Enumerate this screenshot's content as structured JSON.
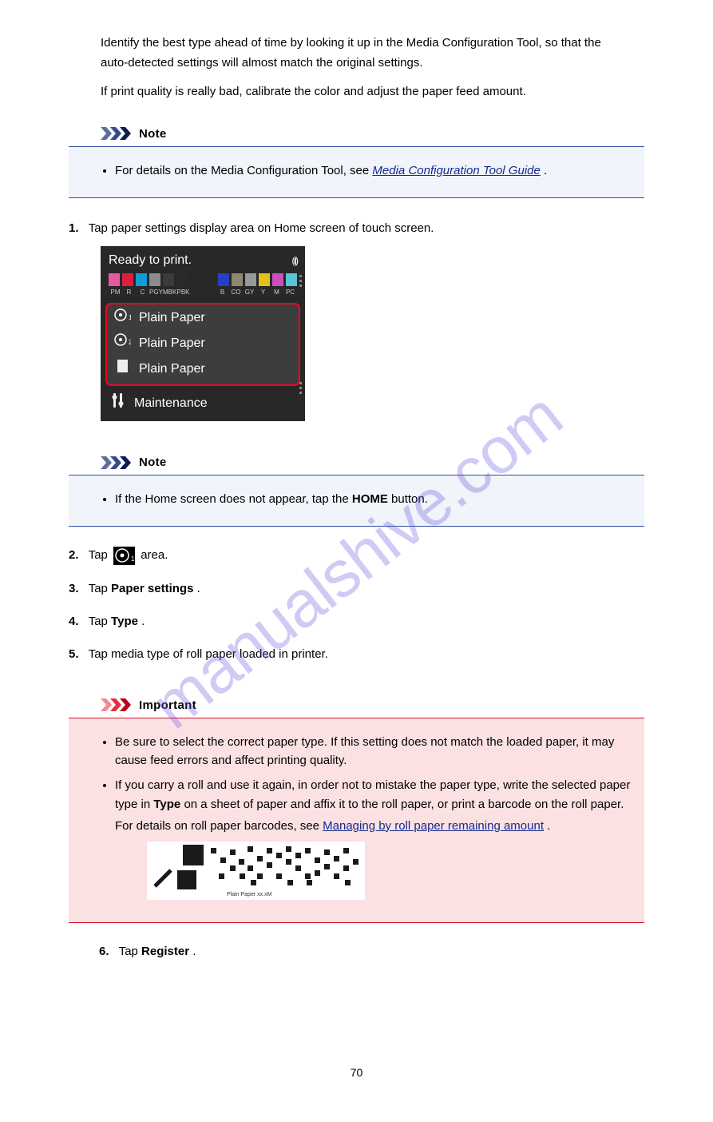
{
  "instructions": {
    "stepA_line1": "Identify the best type ahead of time by looking it up in the Media Configuration Tool, so that the",
    "stepA_line2": "auto-detected settings will almost match the original settings.",
    "stepA_line3": "If print quality is really bad, calibrate the color and adjust the paper feed amount."
  },
  "note1": {
    "header": "Note",
    "bullet_prefix": "For details on the Media Configuration Tool, see ",
    "bullet_link": "Media Configuration Tool Guide",
    "bullet_suffix": "."
  },
  "step1": {
    "label": "1.",
    "text": "Tap paper settings display area on Home screen of touch screen."
  },
  "printer_screen": {
    "status": "Ready to print.",
    "inks_left": [
      "PM",
      "R",
      "C",
      "PGY",
      "MBK",
      "PBK"
    ],
    "inks_right": [
      "B",
      "CO",
      "GY",
      "Y",
      "M",
      "PC"
    ],
    "colors_left": [
      "#e85aa0",
      "#d8203a",
      "#0e9dd6",
      "#8c8c8c",
      "#3b3b3b",
      "#2a2a2a"
    ],
    "colors_right": [
      "#2a3ec2",
      "#8f8770",
      "#999999",
      "#e5c01a",
      "#cc4fbf",
      "#58c6d8"
    ],
    "paper1": "Plain Paper",
    "paper2": "Plain Paper",
    "paper3": "Plain Paper",
    "maintenance": "Maintenance"
  },
  "note2": {
    "header": "Note",
    "bullet": "If the Home screen does not appear, tap the ",
    "bold": "HOME",
    "suffix": " button."
  },
  "step2": {
    "label": "2.",
    "text_prefix": "Tap ",
    "text_suffix": " area."
  },
  "step3": {
    "label": "3.",
    "text_prefix": "Tap ",
    "bold": "Paper settings",
    "text_suffix": "."
  },
  "step4": {
    "label": "4.",
    "text_prefix": "Tap ",
    "bold": "Type",
    "text_suffix": "."
  },
  "step5": {
    "label": "5.",
    "text": "Tap media type of roll paper loaded in printer."
  },
  "important": {
    "header": "Important",
    "bullet1": "Be sure to select the correct paper type. If this setting does not match the loaded paper, it may cause feed errors and affect printing quality.",
    "bullet2_prefix": "If you carry a roll and use it again, in order not to mistake the paper type, write the selected paper type in ",
    "bold": "Type",
    "bullet2_middle": " on a sheet of paper and affix it to the roll paper, or print a barcode on the roll paper.",
    "bullet2_details_prefix": "For details on roll paper barcodes, see ",
    "bullet2_link": "Managing by roll paper remaining amount",
    "bullet2_details_suffix": "."
  },
  "barcode_label": "Plain Paper    xx.xM",
  "step6": {
    "label": "6.",
    "text_prefix": "Tap ",
    "bold": "Register",
    "text_suffix": "."
  },
  "page_number": "70"
}
